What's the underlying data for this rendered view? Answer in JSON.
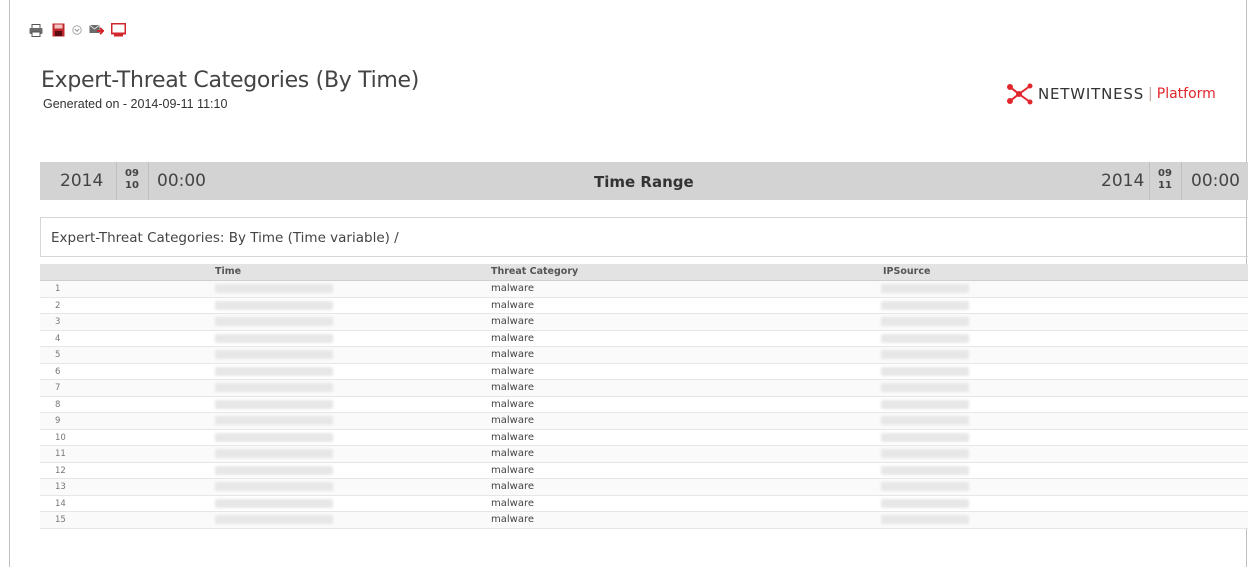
{
  "toolbar": {
    "buttons": [
      {
        "icon": "print-icon"
      },
      {
        "icon": "save-pdf-icon"
      },
      {
        "icon": "dropdown-arrow-icon"
      },
      {
        "icon": "email-icon"
      },
      {
        "icon": "close-report-icon"
      }
    ]
  },
  "report": {
    "title": "Expert-Threat Categories (By Time)",
    "generated": "Generated on - 2014-09-11 11:10",
    "brand": "NETWITNESS",
    "product": "Platform",
    "brand_color": "#e1262d"
  },
  "time_range": {
    "label": "Time Range",
    "start": {
      "year": "2014",
      "month": "09",
      "day": "10",
      "time": "00:00"
    },
    "end": {
      "year": "2014",
      "month": "09",
      "day": "11",
      "time": "00:00"
    }
  },
  "result": {
    "heading": "Expert-Threat Categories: By Time (Time variable) /",
    "columns": [
      "Time",
      "Threat Category",
      "IPSource"
    ],
    "rows": [
      {
        "n": "1",
        "category": "malware"
      },
      {
        "n": "2",
        "category": "malware"
      },
      {
        "n": "3",
        "category": "malware"
      },
      {
        "n": "4",
        "category": "malware"
      },
      {
        "n": "5",
        "category": "malware"
      },
      {
        "n": "6",
        "category": "malware"
      },
      {
        "n": "7",
        "category": "malware"
      },
      {
        "n": "8",
        "category": "malware"
      },
      {
        "n": "9",
        "category": "malware"
      },
      {
        "n": "10",
        "category": "malware"
      },
      {
        "n": "11",
        "category": "malware"
      },
      {
        "n": "12",
        "category": "malware"
      },
      {
        "n": "13",
        "category": "malware"
      },
      {
        "n": "14",
        "category": "malware"
      },
      {
        "n": "15",
        "category": "malware"
      }
    ]
  }
}
